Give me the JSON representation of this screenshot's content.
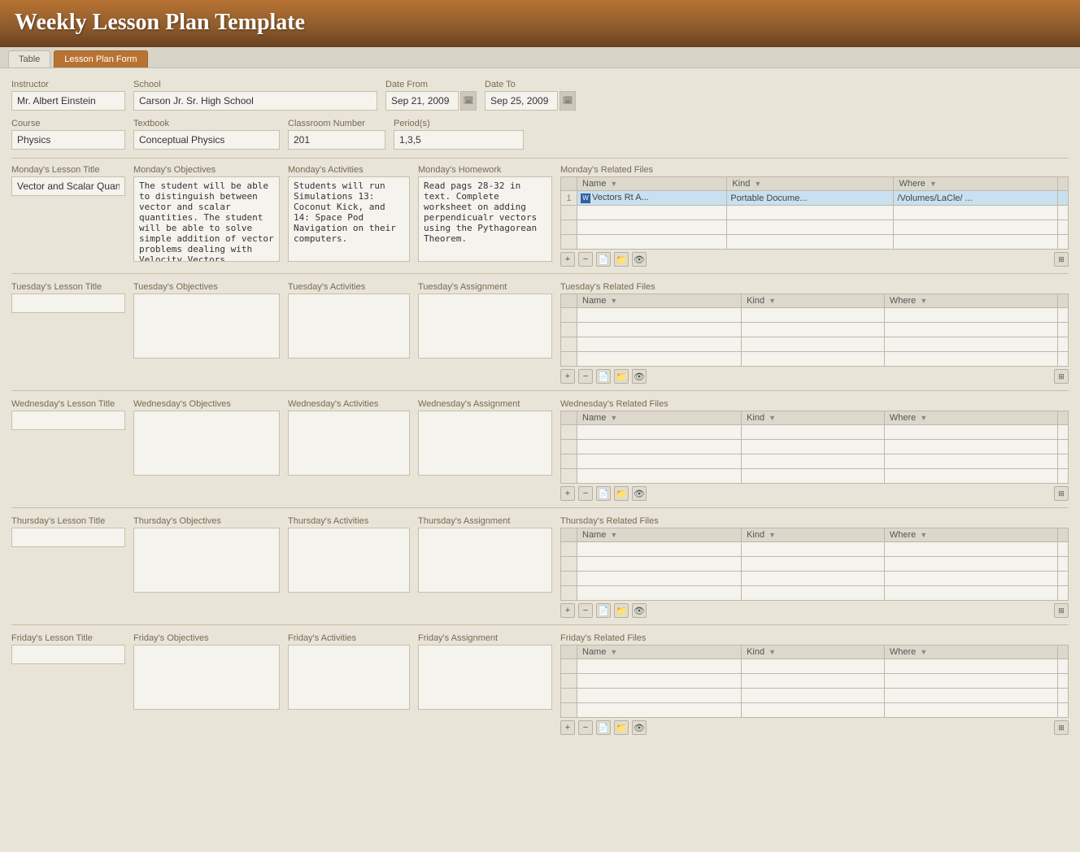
{
  "app": {
    "title": "Weekly Lesson Plan Template"
  },
  "tabs": [
    {
      "id": "table",
      "label": "Table",
      "active": false
    },
    {
      "id": "lesson-plan-form",
      "label": "Lesson Plan Form",
      "active": true
    }
  ],
  "form": {
    "instructor_label": "Instructor",
    "instructor_value": "Mr. Albert Einstein",
    "school_label": "School",
    "school_value": "Carson Jr. Sr. High School",
    "date_from_label": "Date From",
    "date_from_value": "Sep 21, 2009",
    "date_to_label": "Date To",
    "date_to_value": "Sep 25, 2009",
    "course_label": "Course",
    "course_value": "Physics",
    "textbook_label": "Textbook",
    "textbook_value": "Conceptual Physics",
    "classroom_label": "Classroom Number",
    "classroom_value": "201",
    "periods_label": "Period(s)",
    "periods_value": "1,3,5"
  },
  "days": [
    {
      "id": "monday",
      "title_label": "Monday's Lesson Title",
      "title_value": "Vector and Scalar Quantities",
      "objectives_label": "Monday's Objectives",
      "objectives_value": "The student will be able to distinguish between vector and scalar quantities. The student will be able to solve simple addition of vector problems dealing with Velocity Vectors",
      "activities_label": "Monday's Activities",
      "activities_value": "Students will run Simulations 13: Coconut Kick, and 14: Space Pod Navigation on their computers.",
      "homework_label": "Monday's Homework",
      "homework_value": "Read pags 28-32 in text. Complete worksheet on adding perpendicualr vectors using the Pythagorean Theorem.",
      "files_label": "Monday's Related Files",
      "files": [
        {
          "name": "Vectors Rt A...",
          "kind": "Portable Docume...",
          "where": "/Volumes/LaCle/ ..."
        }
      ]
    },
    {
      "id": "tuesday",
      "title_label": "Tuesday's Lesson Title",
      "title_value": "",
      "objectives_label": "Tuesday's Objectives",
      "objectives_value": "",
      "activities_label": "Tuesday's Activities",
      "activities_value": "",
      "homework_label": "Tuesday's Assignment",
      "homework_value": "",
      "files_label": "Tuesday's Related Files",
      "files": []
    },
    {
      "id": "wednesday",
      "title_label": "Wednesday's Lesson Title",
      "title_value": "",
      "objectives_label": "Wednesday's Objectives",
      "objectives_value": "",
      "activities_label": "Wednesday's Activities",
      "activities_value": "",
      "homework_label": "Wednesday's Assignment",
      "homework_value": "",
      "files_label": "Wednesday's Related Files",
      "files": []
    },
    {
      "id": "thursday",
      "title_label": "Thursday's Lesson Title",
      "title_value": "",
      "objectives_label": "Thursday's Objectives",
      "objectives_value": "",
      "activities_label": "Thursday's Activities",
      "activities_value": "",
      "homework_label": "Thursday's Assignment",
      "homework_value": "",
      "files_label": "Thursday's Related Files",
      "files": []
    },
    {
      "id": "friday",
      "title_label": "Friday's Lesson Title",
      "title_value": "",
      "objectives_label": "Friday's Objectives",
      "objectives_value": "",
      "activities_label": "Friday's Activities",
      "activities_value": "",
      "homework_label": "Friday's Assignment",
      "homework_value": "",
      "files_label": "Friday's Related Files",
      "files": []
    }
  ],
  "table_headers": {
    "name": "Name",
    "kind": "Kind",
    "where": "Where"
  },
  "actions": {
    "add": "+",
    "remove": "−",
    "new_doc": "📄",
    "folder": "📁",
    "eye": "👁"
  }
}
